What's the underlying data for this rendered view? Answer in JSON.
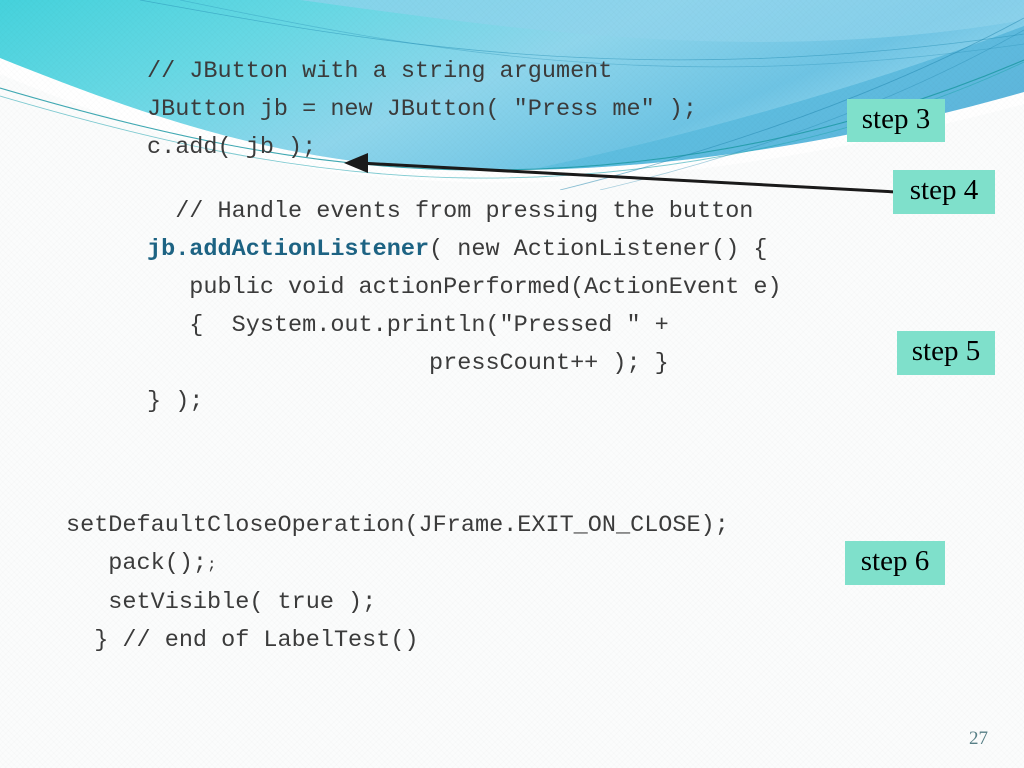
{
  "slide": {
    "page_number": "27",
    "background_color": "#fbfcfc",
    "accent_color": "#7fe0cb",
    "keyword_color": "#1d6383",
    "code_color": "#3b3b3b",
    "header_gradient_from": "#4ed2da",
    "header_gradient_to": "#9fd9ef"
  },
  "code_top": {
    "line1": "// JButton with a string argument",
    "line2": "JButton jb = new JButton( \"Press me\" );",
    "line3": "c.add( jb );"
  },
  "code_mid": {
    "line1": "  // Handle events from pressing the button",
    "line2_keyword": "jb.addActionListener",
    "line2_rest": "( new ActionListener() {",
    "line3": "   public void actionPerformed(ActionEvent e)",
    "line4": "   {  System.out.println(\"Pressed \" +",
    "line5": "                    pressCount++ ); }",
    "line6": "} );"
  },
  "code_bottom": {
    "line1": "setDefaultCloseOperation(JFrame.EXIT_ON_CLOSE);",
    "line2_main": "   pack();",
    "line2_tiny": ";",
    "line3": "   setVisible( true );",
    "line4": "  } // end of LabelTest()"
  },
  "badges": [
    {
      "id": "step3",
      "label": "step 3"
    },
    {
      "id": "step4",
      "label": "step 4"
    },
    {
      "id": "step5",
      "label": "step 5"
    },
    {
      "id": "step6",
      "label": "step 6"
    }
  ]
}
